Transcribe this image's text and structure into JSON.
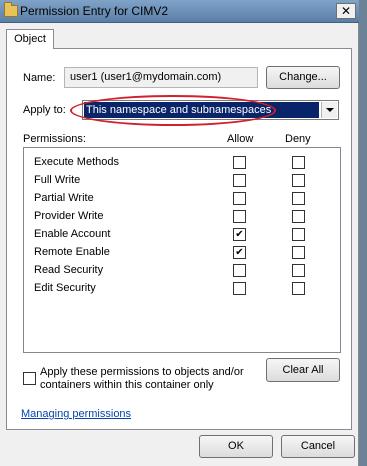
{
  "window": {
    "title": "Permission Entry for CIMV2",
    "close_glyph": "✕"
  },
  "tabs": [
    {
      "label": "Object"
    }
  ],
  "name": {
    "label": "Name:",
    "value": "user1 (user1@mydomain.com)",
    "change_label": "Change..."
  },
  "apply_to": {
    "label": "Apply to:",
    "selected": "This namespace and subnamespaces"
  },
  "permissions": {
    "label": "Permissions:",
    "allow_header": "Allow",
    "deny_header": "Deny",
    "items": [
      {
        "name": "Execute Methods",
        "allow": false,
        "deny": false
      },
      {
        "name": "Full Write",
        "allow": false,
        "deny": false
      },
      {
        "name": "Partial Write",
        "allow": false,
        "deny": false
      },
      {
        "name": "Provider Write",
        "allow": false,
        "deny": false
      },
      {
        "name": "Enable Account",
        "allow": true,
        "deny": false
      },
      {
        "name": "Remote Enable",
        "allow": true,
        "deny": false
      },
      {
        "name": "Read Security",
        "allow": false,
        "deny": false
      },
      {
        "name": "Edit Security",
        "allow": false,
        "deny": false
      }
    ]
  },
  "apply_container": {
    "line1": "Apply these permissions to objects and/or",
    "line2": "containers within this container only",
    "checked": false
  },
  "clear_all_label": "Clear All",
  "managing_link": "Managing permissions",
  "footer": {
    "ok_label": "OK",
    "cancel_label": "Cancel"
  },
  "colors": {
    "selection": "#0a246a",
    "annotation": "#d0212c",
    "link": "#0645ad"
  },
  "icons": {
    "title": "folder-icon",
    "checkmark": "✔"
  }
}
